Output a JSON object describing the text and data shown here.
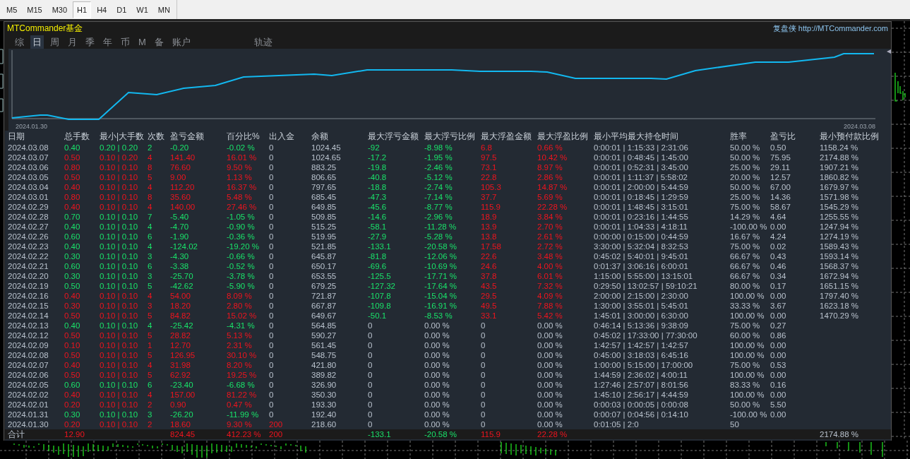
{
  "timeframes": [
    {
      "label": "M5",
      "selected": false
    },
    {
      "label": "M15",
      "selected": false
    },
    {
      "label": "M30",
      "selected": false
    },
    {
      "label": "H1",
      "selected": true
    },
    {
      "label": "H4",
      "selected": false
    },
    {
      "label": "D1",
      "selected": false
    },
    {
      "label": "W1",
      "selected": false
    },
    {
      "label": "MN",
      "selected": false
    }
  ],
  "panel": {
    "title": "MTCommander基金",
    "site": "复盘侠 http://MTCommander.com",
    "tabs": [
      {
        "label": "综",
        "selected": false
      },
      {
        "label": "日",
        "selected": true
      },
      {
        "label": "周",
        "selected": false
      },
      {
        "label": "月",
        "selected": false
      },
      {
        "label": "季",
        "selected": false
      },
      {
        "label": "年",
        "selected": false
      },
      {
        "label": "币",
        "selected": false
      },
      {
        "label": "M",
        "selected": false
      },
      {
        "label": "备",
        "selected": false
      },
      {
        "label": "账户",
        "selected": false
      }
    ],
    "trail_tab": {
      "label": "轨迹",
      "selected": false
    },
    "chart": {
      "start_date": "2024.01.30",
      "end_date": "2024.03.08"
    }
  },
  "table": {
    "columns": [
      "日期",
      "总手数",
      "最小|大手数",
      "次数",
      "盈亏金额",
      "百分比%",
      "出入金",
      "余额",
      "最大浮亏金额",
      "最大浮亏比例",
      "最大浮盈金额",
      "最大浮盈比例",
      "最小平均最大持仓时间",
      "胜率",
      "盈亏比",
      "最小预付款比例"
    ],
    "rows": [
      {
        "date": "2024.03.08",
        "lots": "0.40",
        "minmax": "0.20 | 0.20",
        "count": "2",
        "pnl": "-0.20",
        "pct": "-0.02 %",
        "io": "0",
        "balance": "1024.45",
        "float_loss": "-92",
        "float_loss_pct": "-8.98 %",
        "float_profit": "6.8",
        "float_profit_pct": "0.66 %",
        "hold_time": "0:00:01 | 1:15:33 | 2:31:06",
        "win_rate": "50.00 %",
        "pl_ratio": "0.50",
        "prepay": "1158.24 %",
        "profit": false,
        "float_active": true,
        "deposit": false
      },
      {
        "date": "2024.03.07",
        "lots": "0.50",
        "minmax": "0.10 | 0.20",
        "count": "4",
        "pnl": "141.40",
        "pct": "16.01 %",
        "io": "0",
        "balance": "1024.65",
        "float_loss": "-17.2",
        "float_loss_pct": "-1.95 %",
        "float_profit": "97.5",
        "float_profit_pct": "10.42 %",
        "hold_time": "0:00:01 | 0:48:45 | 1:45:00",
        "win_rate": "50.00 %",
        "pl_ratio": "75.95",
        "prepay": "2174.88 %",
        "profit": true,
        "float_active": true,
        "deposit": false
      },
      {
        "date": "2024.03.06",
        "lots": "0.80",
        "minmax": "0.10 | 0.10",
        "count": "8",
        "pnl": "76.60",
        "pct": "9.50 %",
        "io": "0",
        "balance": "883.25",
        "float_loss": "-19.8",
        "float_loss_pct": "-2.46 %",
        "float_profit": "73.1",
        "float_profit_pct": "8.97 %",
        "hold_time": "0:00:01 | 0:52:31 | 3:45:00",
        "win_rate": "25.00 %",
        "pl_ratio": "29.11",
        "prepay": "1907.21 %",
        "profit": true,
        "float_active": true,
        "deposit": false
      },
      {
        "date": "2024.03.05",
        "lots": "0.50",
        "minmax": "0.10 | 0.10",
        "count": "5",
        "pnl": "9.00",
        "pct": "1.13 %",
        "io": "0",
        "balance": "806.65",
        "float_loss": "-40.8",
        "float_loss_pct": "-5.12 %",
        "float_profit": "22.8",
        "float_profit_pct": "2.86 %",
        "hold_time": "0:00:01 | 1:11:37 | 5:58:02",
        "win_rate": "20.00 %",
        "pl_ratio": "12.57",
        "prepay": "1860.82 %",
        "profit": true,
        "float_active": true,
        "deposit": false
      },
      {
        "date": "2024.03.04",
        "lots": "0.40",
        "minmax": "0.10 | 0.10",
        "count": "4",
        "pnl": "112.20",
        "pct": "16.37 %",
        "io": "0",
        "balance": "797.65",
        "float_loss": "-18.8",
        "float_loss_pct": "-2.74 %",
        "float_profit": "105.3",
        "float_profit_pct": "14.87 %",
        "hold_time": "0:00:01 | 2:00:00 | 5:44:59",
        "win_rate": "50.00 %",
        "pl_ratio": "67.00",
        "prepay": "1679.97 %",
        "profit": true,
        "float_active": true,
        "deposit": false
      },
      {
        "date": "2024.03.01",
        "lots": "0.80",
        "minmax": "0.10 | 0.10",
        "count": "8",
        "pnl": "35.60",
        "pct": "5.48 %",
        "io": "0",
        "balance": "685.45",
        "float_loss": "-47.3",
        "float_loss_pct": "-7.14 %",
        "float_profit": "37.7",
        "float_profit_pct": "5.69 %",
        "hold_time": "0:00:01 | 0:18:45 | 1:29:59",
        "win_rate": "25.00 %",
        "pl_ratio": "14.36",
        "prepay": "1571.98 %",
        "profit": true,
        "float_active": true,
        "deposit": false
      },
      {
        "date": "2024.02.29",
        "lots": "0.40",
        "minmax": "0.10 | 0.10",
        "count": "4",
        "pnl": "140.00",
        "pct": "27.46 %",
        "io": "0",
        "balance": "649.85",
        "float_loss": "-45.6",
        "float_loss_pct": "-8.77 %",
        "float_profit": "115.9",
        "float_profit_pct": "22.28 %",
        "hold_time": "0:00:01 | 1:48:45 | 3:15:01",
        "win_rate": "75.00 %",
        "pl_ratio": "58.67",
        "prepay": "1545.29 %",
        "profit": true,
        "float_active": true,
        "deposit": false
      },
      {
        "date": "2024.02.28",
        "lots": "0.70",
        "minmax": "0.10 | 0.10",
        "count": "7",
        "pnl": "-5.40",
        "pct": "-1.05 %",
        "io": "0",
        "balance": "509.85",
        "float_loss": "-14.6",
        "float_loss_pct": "-2.96 %",
        "float_profit": "18.9",
        "float_profit_pct": "3.84 %",
        "hold_time": "0:00:01 | 0:23:16 | 1:44:55",
        "win_rate": "14.29 %",
        "pl_ratio": "4.64",
        "prepay": "1255.55 %",
        "profit": false,
        "float_active": true,
        "deposit": false
      },
      {
        "date": "2024.02.27",
        "lots": "0.40",
        "minmax": "0.10 | 0.10",
        "count": "4",
        "pnl": "-4.70",
        "pct": "-0.90 %",
        "io": "0",
        "balance": "515.25",
        "float_loss": "-58.1",
        "float_loss_pct": "-11.28 %",
        "float_profit": "13.9",
        "float_profit_pct": "2.70 %",
        "hold_time": "0:00:01 | 1:04:33 | 4:18:11",
        "win_rate": "-100.00 %",
        "pl_ratio": "0.00",
        "prepay": "1247.94 %",
        "profit": false,
        "float_active": true,
        "deposit": false
      },
      {
        "date": "2024.02.26",
        "lots": "0.60",
        "minmax": "0.10 | 0.10",
        "count": "6",
        "pnl": "-1.90",
        "pct": "-0.36 %",
        "io": "0",
        "balance": "519.95",
        "float_loss": "-27.9",
        "float_loss_pct": "-5.28 %",
        "float_profit": "13.8",
        "float_profit_pct": "2.61 %",
        "hold_time": "0:00:00 | 0:15:00 | 0:44:59",
        "win_rate": "16.67 %",
        "pl_ratio": "4.24",
        "prepay": "1274.19 %",
        "profit": false,
        "float_active": true,
        "deposit": false
      },
      {
        "date": "2024.02.23",
        "lots": "0.40",
        "minmax": "0.10 | 0.10",
        "count": "4",
        "pnl": "-124.02",
        "pct": "-19.20 %",
        "io": "0",
        "balance": "521.85",
        "float_loss": "-133.1",
        "float_loss_pct": "-20.58 %",
        "float_profit": "17.58",
        "float_profit_pct": "2.72 %",
        "hold_time": "3:30:00 | 5:32:04 | 8:32:53",
        "win_rate": "75.00 %",
        "pl_ratio": "0.02",
        "prepay": "1589.43 %",
        "profit": false,
        "float_active": true,
        "deposit": false
      },
      {
        "date": "2024.02.22",
        "lots": "0.30",
        "minmax": "0.10 | 0.10",
        "count": "3",
        "pnl": "-4.30",
        "pct": "-0.66 %",
        "io": "0",
        "balance": "645.87",
        "float_loss": "-81.8",
        "float_loss_pct": "-12.06 %",
        "float_profit": "22.6",
        "float_profit_pct": "3.48 %",
        "hold_time": "0:45:02 | 5:40:01 | 9:45:01",
        "win_rate": "66.67 %",
        "pl_ratio": "0.43",
        "prepay": "1593.14 %",
        "profit": false,
        "float_active": true,
        "deposit": false
      },
      {
        "date": "2024.02.21",
        "lots": "0.60",
        "minmax": "0.10 | 0.10",
        "count": "6",
        "pnl": "-3.38",
        "pct": "-0.52 %",
        "io": "0",
        "balance": "650.17",
        "float_loss": "-69.6",
        "float_loss_pct": "-10.69 %",
        "float_profit": "24.6",
        "float_profit_pct": "4.00 %",
        "hold_time": "0:01:37 | 3:06:16 | 6:00:01",
        "win_rate": "66.67 %",
        "pl_ratio": "0.46",
        "prepay": "1568.37 %",
        "profit": false,
        "float_active": true,
        "deposit": false
      },
      {
        "date": "2024.02.20",
        "lots": "0.30",
        "minmax": "0.10 | 0.10",
        "count": "3",
        "pnl": "-25.70",
        "pct": "-3.78 %",
        "io": "0",
        "balance": "653.55",
        "float_loss": "-125.5",
        "float_loss_pct": "-17.71 %",
        "float_profit": "37.8",
        "float_profit_pct": "6.01 %",
        "hold_time": "1:15:00 | 5:55:00 | 13:15:01",
        "win_rate": "66.67 %",
        "pl_ratio": "0.34",
        "prepay": "1672.94 %",
        "profit": false,
        "float_active": true,
        "deposit": false
      },
      {
        "date": "2024.02.19",
        "lots": "0.50",
        "minmax": "0.10 | 0.10",
        "count": "5",
        "pnl": "-42.62",
        "pct": "-5.90 %",
        "io": "0",
        "balance": "679.25",
        "float_loss": "-127.32",
        "float_loss_pct": "-17.64 %",
        "float_profit": "43.5",
        "float_profit_pct": "7.32 %",
        "hold_time": "0:29:50 | 13:02:57 | 59:10:21",
        "win_rate": "80.00 %",
        "pl_ratio": "0.17",
        "prepay": "1651.15 %",
        "profit": false,
        "float_active": true,
        "deposit": false
      },
      {
        "date": "2024.02.16",
        "lots": "0.40",
        "minmax": "0.10 | 0.10",
        "count": "4",
        "pnl": "54.00",
        "pct": "8.09 %",
        "io": "0",
        "balance": "721.87",
        "float_loss": "-107.8",
        "float_loss_pct": "-15.04 %",
        "float_profit": "29.5",
        "float_profit_pct": "4.09 %",
        "hold_time": "2:00:00 | 2:15:00 | 2:30:00",
        "win_rate": "100.00 %",
        "pl_ratio": "0.00",
        "prepay": "1797.40 %",
        "profit": true,
        "float_active": true,
        "deposit": false
      },
      {
        "date": "2024.02.15",
        "lots": "0.30",
        "minmax": "0.10 | 0.10",
        "count": "3",
        "pnl": "18.20",
        "pct": "2.80 %",
        "io": "0",
        "balance": "667.87",
        "float_loss": "-109.8",
        "float_loss_pct": "-16.91 %",
        "float_profit": "49.5",
        "float_profit_pct": "7.88 %",
        "hold_time": "1:30:00 | 3:55:01 | 5:45:01",
        "win_rate": "33.33 %",
        "pl_ratio": "3.67",
        "prepay": "1623.18 %",
        "profit": true,
        "float_active": true,
        "deposit": false
      },
      {
        "date": "2024.02.14",
        "lots": "0.50",
        "minmax": "0.10 | 0.10",
        "count": "5",
        "pnl": "84.82",
        "pct": "15.02 %",
        "io": "0",
        "balance": "649.67",
        "float_loss": "-50.1",
        "float_loss_pct": "-8.53 %",
        "float_profit": "33.1",
        "float_profit_pct": "5.42 %",
        "hold_time": "1:45:01 | 3:00:00 | 6:30:00",
        "win_rate": "100.00 %",
        "pl_ratio": "0.00",
        "prepay": "1470.29 %",
        "profit": true,
        "float_active": true,
        "deposit": false
      },
      {
        "date": "2024.02.13",
        "lots": "0.40",
        "minmax": "0.10 | 0.10",
        "count": "4",
        "pnl": "-25.42",
        "pct": "-4.31 %",
        "io": "0",
        "balance": "564.85",
        "float_loss": "0",
        "float_loss_pct": "0.00 %",
        "float_profit": "0",
        "float_profit_pct": "0.00 %",
        "hold_time": "0:46:14 | 5:13:36 | 9:38:09",
        "win_rate": "75.00 %",
        "pl_ratio": "0.27",
        "profit": false,
        "float_active": false,
        "deposit": false
      },
      {
        "date": "2024.02.12",
        "lots": "0.50",
        "minmax": "0.10 | 0.10",
        "count": "5",
        "pnl": "28.82",
        "pct": "5.13 %",
        "io": "0",
        "balance": "590.27",
        "float_loss": "0",
        "float_loss_pct": "0.00 %",
        "float_profit": "0",
        "float_profit_pct": "0.00 %",
        "hold_time": "0:45:02 | 17:33:00 | 77:30:00",
        "win_rate": "60.00 %",
        "pl_ratio": "0.86",
        "profit": true,
        "float_active": false,
        "deposit": false
      },
      {
        "date": "2024.02.09",
        "lots": "0.10",
        "minmax": "0.10 | 0.10",
        "count": "1",
        "pnl": "12.70",
        "pct": "2.31 %",
        "io": "0",
        "balance": "561.45",
        "float_loss": "0",
        "float_loss_pct": "0.00 %",
        "float_profit": "0",
        "float_profit_pct": "0.00 %",
        "hold_time": "1:42:57 | 1:42:57 | 1:42:57",
        "win_rate": "100.00 %",
        "pl_ratio": "0.00",
        "profit": true,
        "float_active": false,
        "deposit": false
      },
      {
        "date": "2024.02.08",
        "lots": "0.50",
        "minmax": "0.10 | 0.10",
        "count": "5",
        "pnl": "126.95",
        "pct": "30.10 %",
        "io": "0",
        "balance": "548.75",
        "float_loss": "0",
        "float_loss_pct": "0.00 %",
        "float_profit": "0",
        "float_profit_pct": "0.00 %",
        "hold_time": "0:45:00 | 3:18:03 | 6:45:16",
        "win_rate": "100.00 %",
        "pl_ratio": "0.00",
        "profit": true,
        "float_active": false,
        "deposit": false
      },
      {
        "date": "2024.02.07",
        "lots": "0.40",
        "minmax": "0.10 | 0.10",
        "count": "4",
        "pnl": "31.98",
        "pct": "8.20 %",
        "io": "0",
        "balance": "421.80",
        "float_loss": "0",
        "float_loss_pct": "0.00 %",
        "float_profit": "0",
        "float_profit_pct": "0.00 %",
        "hold_time": "1:00:00 | 5:15:00 | 17:00:00",
        "win_rate": "75.00 %",
        "pl_ratio": "0.53",
        "profit": true,
        "float_active": false,
        "deposit": false
      },
      {
        "date": "2024.02.06",
        "lots": "0.50",
        "minmax": "0.10 | 0.10",
        "count": "5",
        "pnl": "62.92",
        "pct": "19.25 %",
        "io": "0",
        "balance": "389.82",
        "float_loss": "0",
        "float_loss_pct": "0.00 %",
        "float_profit": "0",
        "float_profit_pct": "0.00 %",
        "hold_time": "1:44:59 | 2:36:02 | 4:00:11",
        "win_rate": "100.00 %",
        "pl_ratio": "0.00",
        "profit": true,
        "float_active": false,
        "deposit": false
      },
      {
        "date": "2024.02.05",
        "lots": "0.60",
        "minmax": "0.10 | 0.10",
        "count": "6",
        "pnl": "-23.40",
        "pct": "-6.68 %",
        "io": "0",
        "balance": "326.90",
        "float_loss": "0",
        "float_loss_pct": "0.00 %",
        "float_profit": "0",
        "float_profit_pct": "0.00 %",
        "hold_time": "1:27:46 | 2:57:07 | 8:01:56",
        "win_rate": "83.33 %",
        "pl_ratio": "0.16",
        "profit": false,
        "float_active": false,
        "deposit": false
      },
      {
        "date": "2024.02.02",
        "lots": "0.40",
        "minmax": "0.10 | 0.10",
        "count": "4",
        "pnl": "157.00",
        "pct": "81.22 %",
        "io": "0",
        "balance": "350.30",
        "float_loss": "0",
        "float_loss_pct": "0.00 %",
        "float_profit": "0",
        "float_profit_pct": "0.00 %",
        "hold_time": "1:45:10 | 2:56:17 | 4:44:59",
        "win_rate": "100.00 %",
        "pl_ratio": "0.00",
        "profit": true,
        "float_active": false,
        "deposit": false
      },
      {
        "date": "2024.02.01",
        "lots": "0.20",
        "minmax": "0.10 | 0.10",
        "count": "2",
        "pnl": "0.90",
        "pct": "0.47 %",
        "io": "0",
        "balance": "193.30",
        "float_loss": "0",
        "float_loss_pct": "0.00 %",
        "float_profit": "0",
        "float_profit_pct": "0.00 %",
        "hold_time": "0:00:03 | 0:00:05 | 0:00:08",
        "win_rate": "50.00 %",
        "pl_ratio": "5.50",
        "profit": true,
        "float_active": false,
        "deposit": false
      },
      {
        "date": "2024.01.31",
        "lots": "0.30",
        "minmax": "0.10 | 0.10",
        "count": "3",
        "pnl": "-26.20",
        "pct": "-11.99 %",
        "io": "0",
        "balance": "192.40",
        "float_loss": "0",
        "float_loss_pct": "0.00 %",
        "float_profit": "0",
        "float_profit_pct": "0.00 %",
        "hold_time": "0:00:07 | 0:04:56 | 0:14:10",
        "win_rate": "-100.00 %",
        "pl_ratio": "0.00",
        "profit": false,
        "float_active": false,
        "deposit": false
      },
      {
        "date": "2024.01.30",
        "lots": "0.20",
        "minmax": "0.10 | 0.10",
        "count": "2",
        "pnl": "18.60",
        "pct": "9.30 %",
        "io": "200",
        "balance": "218.60",
        "float_loss": "0",
        "float_loss_pct": "0.00 %",
        "float_profit": "0",
        "float_profit_pct": "0.00 %",
        "hold_time": "0:01:05 | 2:0",
        "win_rate": "50",
        "profit": true,
        "float_active": false,
        "deposit": true
      }
    ],
    "totals": {
      "label": "合计",
      "lots": "12.90",
      "pnl": "824.45",
      "pct": "412.23 %",
      "io": "200",
      "float_loss": "-133.1",
      "float_loss_pct": "-20.58 %",
      "float_profit": "115.9",
      "float_profit_pct": "22.28 %",
      "prepay": "2174.88 %",
      "profit": true,
      "deposit": true
    }
  }
}
